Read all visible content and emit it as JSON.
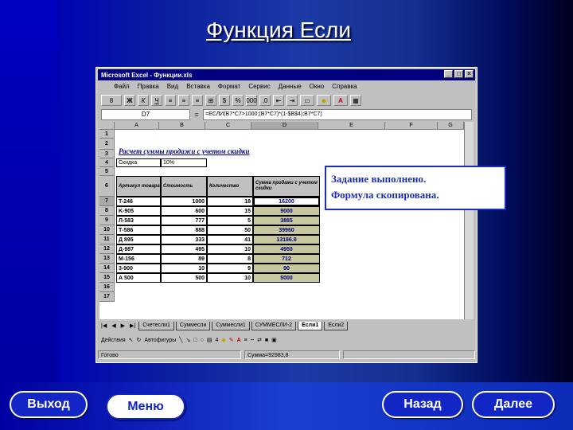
{
  "title": "Функция Если",
  "excel": {
    "window_title": "Microsoft Excel - Функции.xls",
    "menu": [
      "Файл",
      "Правка",
      "Вид",
      "Вставка",
      "Формат",
      "Сервис",
      "Данные",
      "Окно",
      "Справка"
    ],
    "name_box": "D7",
    "formula": "=ЕСЛИ(B7*C7>1000;(B7*C7)*(1-$B$4);B7*C7)",
    "columns": [
      "A",
      "B",
      "C",
      "D",
      "E",
      "F",
      "G"
    ],
    "rows": [
      "1",
      "2",
      "3",
      "4",
      "5",
      "6",
      "7",
      "8",
      "9",
      "10",
      "11",
      "12",
      "13",
      "14",
      "15",
      "16",
      "17"
    ],
    "heading": "Расчет суммы продажи с учетом скидки",
    "discount_label": "Скидка",
    "discount_value": "10%",
    "table_headers": [
      "Артикул товара",
      "Стоимость",
      "Количество",
      "Сумма продажи с учетом скидки"
    ],
    "table_rows": [
      [
        "T-246",
        "1000",
        "18",
        "16200"
      ],
      [
        "K-905",
        "600",
        "15",
        "9000"
      ],
      [
        "Л-583",
        "777",
        "5",
        "3885"
      ],
      [
        "Т-586",
        "888",
        "50",
        "39960"
      ],
      [
        "Д 895",
        "333",
        "41",
        "13186.8"
      ],
      [
        "Д-987",
        "495",
        "10",
        "4950"
      ],
      [
        "M-156",
        "89",
        "8",
        "712"
      ],
      [
        "3-900",
        "10",
        "9",
        "90"
      ],
      [
        "А 500",
        "500",
        "10",
        "5000"
      ]
    ],
    "sheet_tabs": [
      "Счетесли1",
      "Суммесли",
      "Суммесли1",
      "СУММЕСЛИ-2",
      "Если1",
      "Если2"
    ],
    "active_tab": "Если1",
    "draw_actions": "Действия",
    "draw_autoshapes": "Автофигуры",
    "status_ready": "Готово",
    "status_sum": "Сумма=92983,8"
  },
  "callout": {
    "line1": "Задание выполнено.",
    "line2": "Формула скопирована."
  },
  "nav": {
    "exit": "Выход",
    "menu": "Меню",
    "back": "Назад",
    "next": "Далее"
  }
}
